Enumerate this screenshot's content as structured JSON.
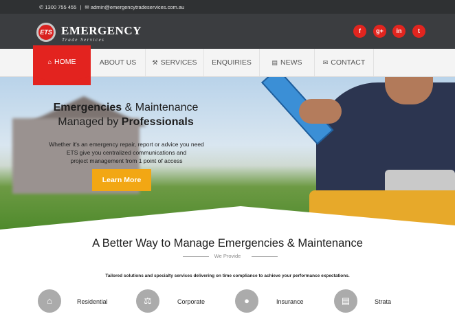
{
  "topbar": {
    "phone": "1300 755 455",
    "divider": "|",
    "email": "admin@emergencytradeservices.com.au",
    "phone_icon": "phone-icon",
    "email_icon": "envelope-icon"
  },
  "brand": {
    "mark": "ETS",
    "name": "EMERGENCY",
    "tagline": "Trade Services"
  },
  "social": [
    {
      "glyph": "f",
      "icon": "facebook-icon"
    },
    {
      "glyph": "g+",
      "icon": "google-plus-icon"
    },
    {
      "glyph": "in",
      "icon": "linkedin-icon"
    },
    {
      "glyph": "t",
      "icon": "twitter-icon"
    }
  ],
  "nav": {
    "home": "HOME",
    "about": "ABOUT US",
    "services": "SERVICES",
    "enquiries": "ENQUIRIES",
    "news": "NEWS",
    "contact": "CONTACT",
    "active_color": "#e3231f"
  },
  "hero": {
    "title_line1_bold": "Emergencies",
    "title_line1_rest": "& Maintenance",
    "title_line2_plain": "Managed by",
    "title_line2_bold": "Professionals",
    "text_line1": "Whether it's an emergency repair, report or advice you need",
    "text_line2": "ETS give you centralized communications and",
    "text_line3": "project management from 1 point of access",
    "button": "Learn More",
    "button_color": "#f2a714"
  },
  "section": {
    "title": "A Better Way to Manage Emergencies & Maintenance",
    "subtitle": "We Provide",
    "description": "Tailored solutions and specialty services delivering on time compliance to achieve your performance expectations."
  },
  "services": [
    {
      "label": "Residential",
      "icon": "home-icon"
    },
    {
      "label": "Corporate",
      "icon": "bank-icon"
    },
    {
      "label": "Insurance",
      "icon": "people-icon"
    },
    {
      "label": "Strata",
      "icon": "building-icon"
    }
  ]
}
